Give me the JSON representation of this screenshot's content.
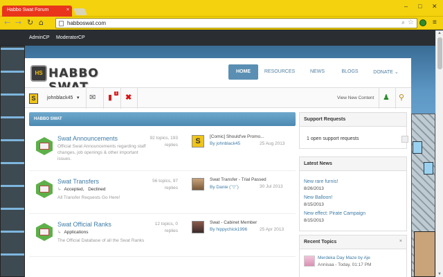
{
  "browser": {
    "tab_title": "Habbo Swat Forum",
    "tab_close": "×",
    "url": "habboswat.com",
    "window_controls": [
      "–",
      "□",
      "✕"
    ]
  },
  "adminbar": {
    "items": [
      "AdminCP",
      "ModeratorCP"
    ]
  },
  "site": {
    "logo_badge": "HS",
    "logo_text": "HABBO SWAT",
    "nav": [
      {
        "label": "HOME",
        "active": true
      },
      {
        "label": "RESOURCES"
      },
      {
        "label": "NEWS"
      },
      {
        "label": "BLOGS"
      },
      {
        "label": "DONATE ⌄"
      }
    ]
  },
  "userbar": {
    "avatar_letter": "S",
    "username": "johnblack45",
    "caret": "▾",
    "notif_count": "1",
    "view_new": "View New Content"
  },
  "section": {
    "title": "HABBO SWAT"
  },
  "forums": [
    {
      "title": "Swat Announcements",
      "description": "Official Swat Announcements regarding staff changes, job openings & other important issues.",
      "stats_topics": "92 topics, 193",
      "stats_replies": "replies",
      "last_title": "[Comic] Should've Promo...",
      "last_by": "By johnblack45",
      "last_date": "25 Aug 2013"
    },
    {
      "title": "Swat Transfers",
      "subforums": [
        "Accepted,",
        "Declined"
      ],
      "description": "All Transfer Requests Go Here!",
      "stats_topics": "56 topics, 97",
      "stats_replies": "replies",
      "last_title": "Swat Transfer - Trial Passed",
      "last_by": "By Danie (`▽´)",
      "last_date": "30 Jul 2013"
    },
    {
      "title": "Swat Official Ranks",
      "subforums": [
        "Applications"
      ],
      "description": "The Official Database of all the Swat Ranks",
      "stats_topics": "12 topics, 0",
      "stats_replies": "replies",
      "last_title": "Swat - Cabinet Member",
      "last_by": "By hippychick1996",
      "last_date": "25 Apr 2013"
    }
  ],
  "sidebar": {
    "support": {
      "title": "Support Requests",
      "text": "1 open support requests"
    },
    "news": {
      "title": "Latest News",
      "items": [
        {
          "title": "New rare furnis!",
          "date": "8/26/2013"
        },
        {
          "title": "New Balloon!",
          "date": "8/15/2013"
        },
        {
          "title": "New effect: Pirate Campaign",
          "date": "8/15/2013"
        }
      ]
    },
    "recent": {
      "title": "Recent Topics",
      "close": "×",
      "item_title": "Merdeka Day Maze by Aje",
      "item_meta": "Annisaa - Today, 01:17 PM"
    }
  },
  "colors": {
    "chrome": "#f4d20d",
    "tab": "#e8351c",
    "accent": "#5a8fb3",
    "link": "#3d7ba6",
    "forum_icon": "#5db049"
  }
}
